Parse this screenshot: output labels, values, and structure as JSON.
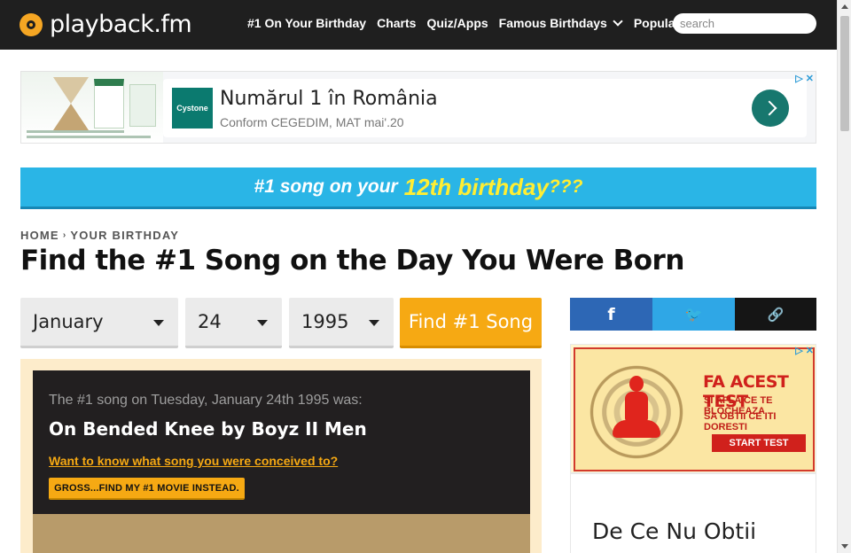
{
  "header": {
    "logo_text": "playback.fm",
    "nav": [
      {
        "label": "#1 On Your Birthday",
        "has_dropdown": false
      },
      {
        "label": "Charts",
        "has_dropdown": false
      },
      {
        "label": "Quiz/Apps",
        "has_dropdown": false
      },
      {
        "label": "Famous Birthdays",
        "has_dropdown": true
      },
      {
        "label": "Popular",
        "has_dropdown": true
      }
    ],
    "search_placeholder": "search"
  },
  "ad_top": {
    "brand": "Cystone",
    "headline": "Numărul 1 în România",
    "subline": "Conform CEGEDIM, MAT mai'.20",
    "adchoice": "▷ ✕"
  },
  "banner": {
    "text_before": "#1 song on your",
    "highlight": "12th birthday",
    "suffix": "???"
  },
  "breadcrumb": {
    "home": "HOME",
    "separator": "›",
    "current": "YOUR BIRTHDAY"
  },
  "page_title": "Find the #1 Song on the Day You Were Born",
  "form": {
    "month": "January",
    "day": "24",
    "year": "1995",
    "submit_label": "Find #1 Song"
  },
  "result": {
    "intro": "The #1 song on Tuesday, January 24th 1995 was:",
    "song": "On Bended Knee by Boyz II Men",
    "conceived_link": "Want to know what song you were conceived to?",
    "movie_button": "GROSS...FIND MY #1 MOVIE INSTEAD."
  },
  "share": {
    "facebook": "f",
    "twitter": "🐦",
    "link": "🔗"
  },
  "side_ad": {
    "title": "FA ACEST TEST",
    "line1": "SI AFLA CE TE BLOCHEAZA",
    "line2": "SA OBTII CE ITI DORESTI",
    "button": "START TEST",
    "adchoice": "▷ ✕"
  },
  "side_card": {
    "title": "De Ce Nu Obtii"
  },
  "colors": {
    "header_bg": "#1f1f1f",
    "accent_orange": "#f6a913",
    "banner_blue": "#2ab5e6",
    "banner_yellow": "#ffee33",
    "facebook": "#2d67b5",
    "twitter": "#2fa7e6"
  }
}
